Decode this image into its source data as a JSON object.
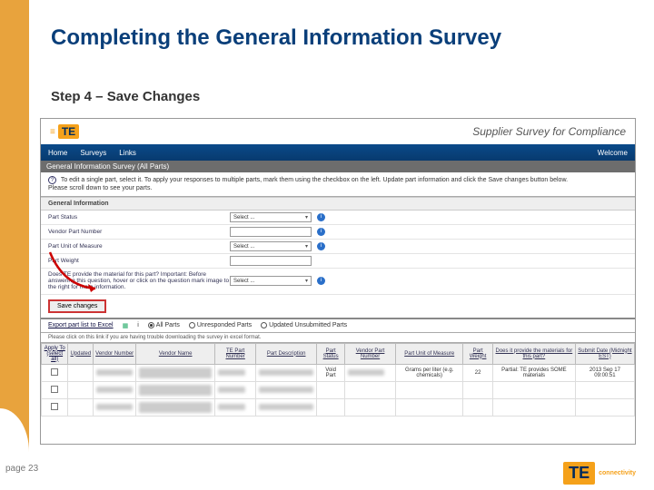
{
  "slide": {
    "title": "Completing the General Information Survey",
    "subtitle": "Step 4 – Save Changes",
    "page": "page 23"
  },
  "footer_logo": {
    "brand": "TE",
    "tag": "connectivity"
  },
  "shot": {
    "logo_brand": "TE",
    "logo_tag": "connectivity",
    "header_title": "Supplier Survey for Compliance",
    "nav": {
      "home": "Home",
      "surveys": "Surveys",
      "links": "Links",
      "welcome": "Welcome"
    },
    "survey_bar": "General Information Survey (All Parts)",
    "instructions": "To edit a single part, select it. To apply your responses to multiple parts, mark them using the checkbox on the left. Update part information and click the Save changes button below.",
    "instructions2": "Please scroll down to see your parts.",
    "section": "General Information",
    "fields": {
      "part_status": "Part Status",
      "vendor_part_number": "Vendor Part Number",
      "unit_measure": "Part Unit of Measure",
      "part_weight": "Part Weight",
      "te_provide": "Does TE provide the material for this part? Important: Before answering this question, hover or click on the question mark image to the right for more information.",
      "select_placeholder": "Select ..."
    },
    "save_button": "Save changes",
    "export": {
      "link": "Export part list to Excel",
      "opt_all": "All Parts",
      "opt_unresp": "Unresponded Parts",
      "opt_updated": "Updated Unsubmitted Parts",
      "hint": "Please click on this link if you are having trouble downloading the survey in excel format."
    },
    "table": {
      "apply_to": "Apply To",
      "select_all": "(select all)",
      "updated": "Updated",
      "vendor_number": "Vendor Number",
      "vendor_name": "Vendor Name",
      "te_part_number": "TE Part Number",
      "part_description": "Part Description",
      "part_status": "Part Status",
      "vendor_part_number": "Vendor Part Number",
      "part_unit": "Part Unit of Measure",
      "part_weight": "Part Weight",
      "does_provide": "Does it provide the materials for this part?",
      "submit_date": "Submit Date (Midnight EST)",
      "void_part": "Void Part",
      "unit_ex": "Grams per liter (e.g. chemicals)",
      "weight_ex": "22",
      "provide_ex": "Partial: TE provides SOME materials",
      "date_ex": "2013 Sep 17 09:00:51"
    }
  }
}
